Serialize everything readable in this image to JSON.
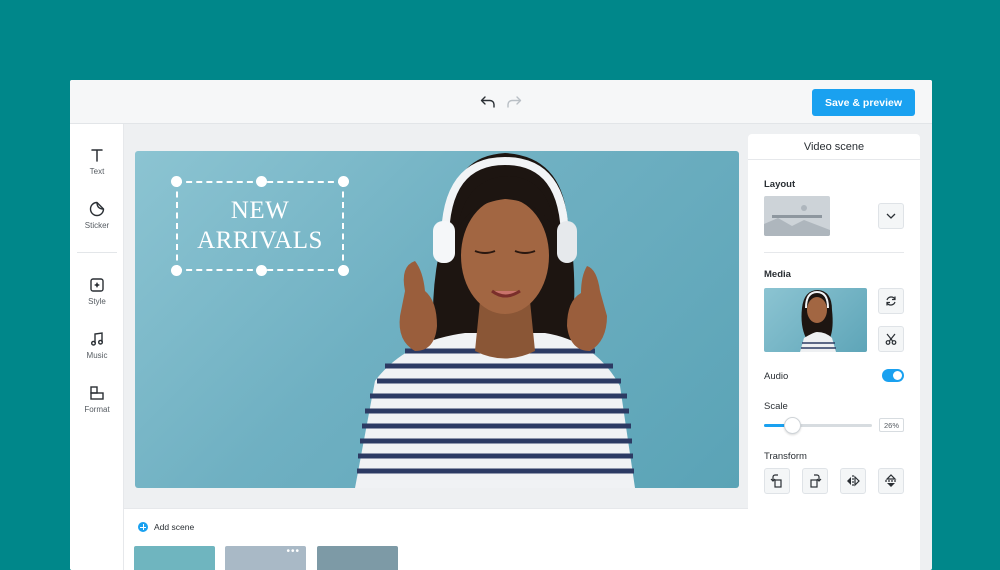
{
  "topbar": {
    "undo_icon": "undo-icon",
    "redo_icon": "redo-icon",
    "save_label": "Save & preview"
  },
  "tools": [
    {
      "label": "Text",
      "icon": "text-icon"
    },
    {
      "label": "Sticker",
      "icon": "sticker-icon"
    },
    {
      "label": "Style",
      "icon": "style-icon"
    },
    {
      "label": "Music",
      "icon": "music-icon"
    },
    {
      "label": "Format",
      "icon": "format-icon"
    }
  ],
  "canvas": {
    "overlay_text": "NEW\nARRIVALS"
  },
  "panel": {
    "title": "Video scene",
    "layout_label": "Layout",
    "media_label": "Media",
    "audio_label": "Audio",
    "audio_on": true,
    "scale_label": "Scale",
    "scale_value": "26%",
    "scale_fraction": 0.26,
    "transform_label": "Transform",
    "transform_icons": [
      "rotate-left-icon",
      "rotate-right-icon",
      "flip-horizontal-icon",
      "flip-vertical-icon"
    ]
  },
  "scenes": {
    "add_label": "Add scene",
    "thumb_colors": [
      "#6fb5bf",
      "#a9b9c6",
      "#7d9aa6"
    ],
    "menu_dots": "•••"
  },
  "colors": {
    "accent": "#1aa1f0",
    "background": "#00878a"
  }
}
